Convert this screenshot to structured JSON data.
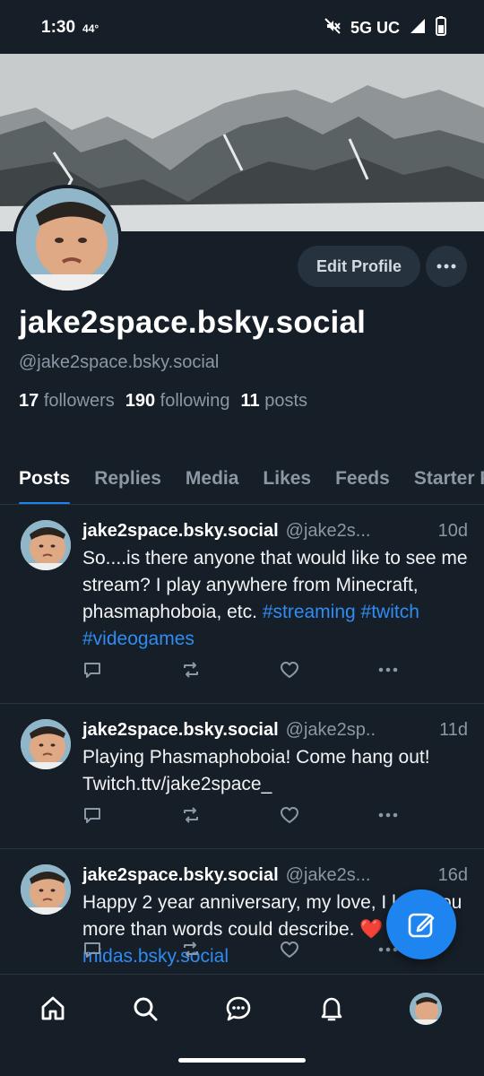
{
  "status_bar": {
    "time": "1:30",
    "temperature": "44°",
    "network": "5G UC",
    "icons": [
      "mute-icon",
      "signal-icon",
      "battery-icon"
    ]
  },
  "profile": {
    "display_name": "jake2space.bsky.social",
    "handle": "@jake2space.bsky.social",
    "edit_button_label": "Edit Profile",
    "more_button_label": "•••",
    "followers_count": "17",
    "followers_label": "followers",
    "following_count": "190",
    "following_label": "following",
    "posts_count": "11",
    "posts_label": "posts"
  },
  "tabs": [
    {
      "label": "Posts",
      "active": true
    },
    {
      "label": "Replies"
    },
    {
      "label": "Media"
    },
    {
      "label": "Likes"
    },
    {
      "label": "Feeds"
    },
    {
      "label": "Starter Packs"
    }
  ],
  "posts": [
    {
      "name": "jake2space.bsky.social",
      "handle": "@jake2s...",
      "time": "10d",
      "text_parts": [
        {
          "text": "So....is there anyone that would like to see me stream? I play anywhere from Minecraft, phasmaphoboia, etc. "
        },
        {
          "text": "#streaming",
          "link": true
        },
        {
          "text": " "
        },
        {
          "text": "#twitch",
          "link": true
        },
        {
          "text": " "
        },
        {
          "text": "#videogames",
          "link": true
        }
      ]
    },
    {
      "name": "jake2space.bsky.social",
      "handle": "@jake2sp..",
      "time": "11d",
      "text_parts": [
        {
          "text": "Playing Phasmaphoboia! Come hang out! Twitch.ttv/jake2space_"
        }
      ]
    },
    {
      "name": "jake2space.bsky.social",
      "handle": "@jake2s...",
      "time": "16d",
      "text_parts": [
        {
          "text": "Happy 2 year anniversary, my love, I love you more than words could describe. ❤️ "
        },
        {
          "text": "@dust-midas.bsky.social",
          "link": true
        }
      ]
    }
  ],
  "colors": {
    "background": "#161e27",
    "accent": "#1d84f0",
    "link": "#2f8cf2",
    "muted": "#8b97a4"
  },
  "bottom_nav": [
    "home-icon",
    "search-icon",
    "chat-icon",
    "bell-icon",
    "profile-avatar"
  ]
}
